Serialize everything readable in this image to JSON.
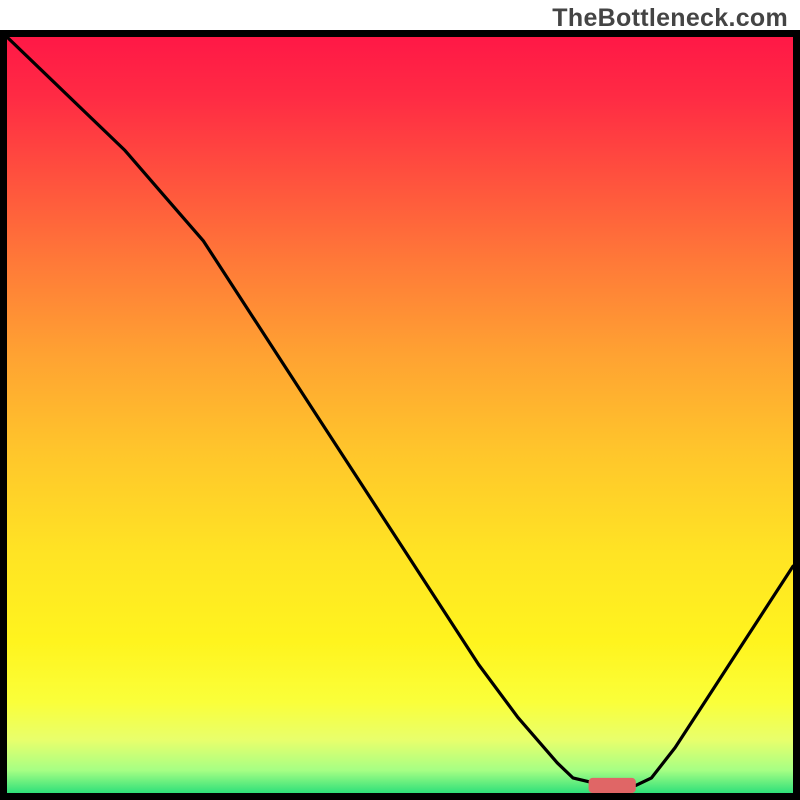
{
  "watermark": "TheBottleneck.com",
  "chart_data": {
    "type": "line",
    "title": "",
    "xlabel": "",
    "ylabel": "",
    "xlim": [
      0,
      100
    ],
    "ylim": [
      0,
      100
    ],
    "grid": false,
    "legend": false,
    "background_gradient": {
      "stops": [
        {
          "offset": 0.0,
          "color": "#ff1846"
        },
        {
          "offset": 0.08,
          "color": "#ff2b44"
        },
        {
          "offset": 0.18,
          "color": "#ff4f3e"
        },
        {
          "offset": 0.3,
          "color": "#ff7a38"
        },
        {
          "offset": 0.42,
          "color": "#ffa232"
        },
        {
          "offset": 0.55,
          "color": "#ffc62b"
        },
        {
          "offset": 0.68,
          "color": "#ffe324"
        },
        {
          "offset": 0.8,
          "color": "#fff41e"
        },
        {
          "offset": 0.88,
          "color": "#faff3a"
        },
        {
          "offset": 0.93,
          "color": "#e8ff6c"
        },
        {
          "offset": 0.97,
          "color": "#a6ff84"
        },
        {
          "offset": 1.0,
          "color": "#2fe07a"
        }
      ]
    },
    "series": [
      {
        "name": "bottleneck-curve",
        "color": "#000000",
        "x": [
          0,
          5,
          10,
          15,
          20,
          25,
          30,
          35,
          40,
          45,
          50,
          55,
          60,
          65,
          70,
          72,
          76,
          80,
          82,
          85,
          90,
          95,
          100
        ],
        "values": [
          100,
          95,
          90,
          85,
          79,
          73,
          65,
          57,
          49,
          41,
          33,
          25,
          17,
          10,
          4,
          2,
          1,
          1,
          2,
          6,
          14,
          22,
          30
        ]
      }
    ],
    "marker": {
      "name": "optimal-marker",
      "color": "#e06666",
      "x_range": [
        74,
        80
      ],
      "y": 1,
      "thickness": 2
    },
    "frame_color": "#000000",
    "frame_width": 7
  }
}
